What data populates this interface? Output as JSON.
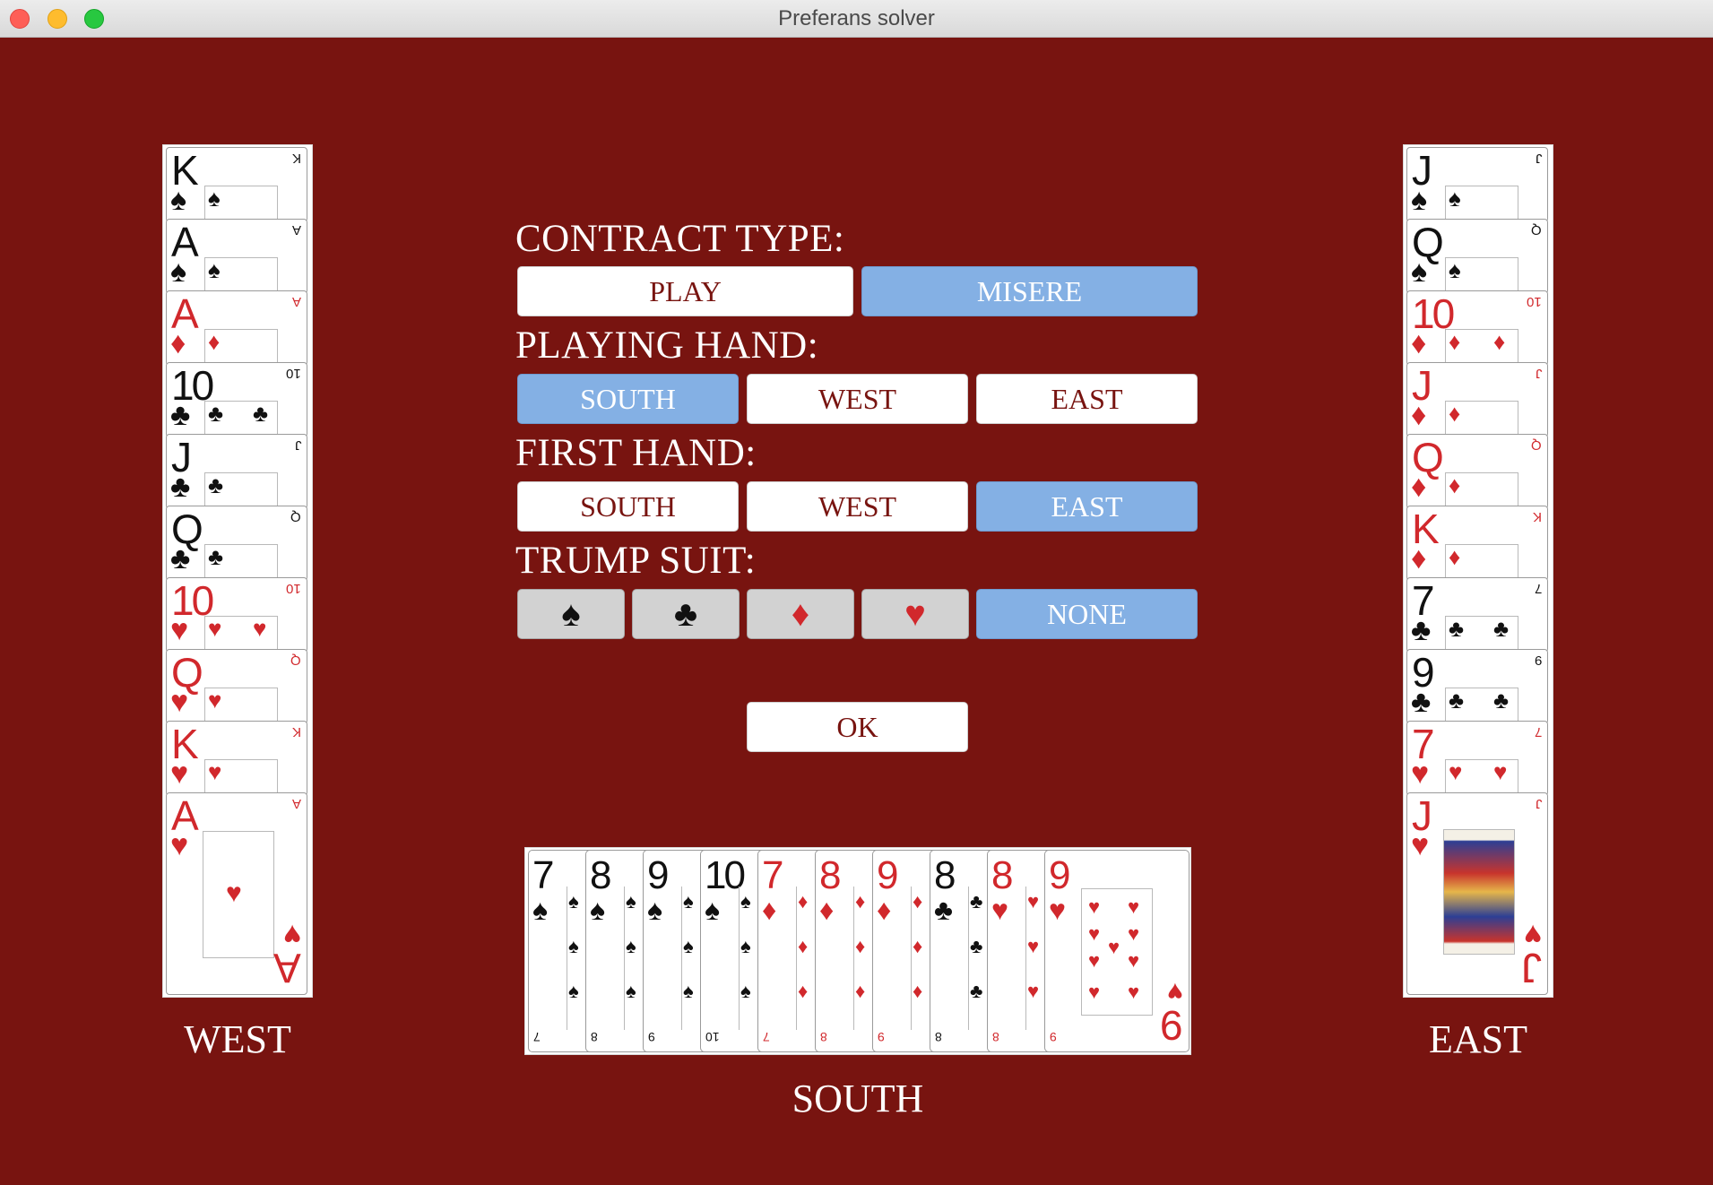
{
  "window": {
    "title": "Preferans solver"
  },
  "colors": {
    "table": "#781410",
    "selected": "#84b0e4",
    "red_suit": "#d1282c",
    "black_suit": "#111111"
  },
  "west": {
    "label": "WEST",
    "cards": [
      {
        "rank": "K",
        "suit": "♠",
        "color": "black"
      },
      {
        "rank": "A",
        "suit": "♠",
        "color": "black"
      },
      {
        "rank": "A",
        "suit": "♦",
        "color": "red"
      },
      {
        "rank": "10",
        "suit": "♣",
        "color": "black"
      },
      {
        "rank": "J",
        "suit": "♣",
        "color": "black"
      },
      {
        "rank": "Q",
        "suit": "♣",
        "color": "black"
      },
      {
        "rank": "10",
        "suit": "♥",
        "color": "red"
      },
      {
        "rank": "Q",
        "suit": "♥",
        "color": "red"
      },
      {
        "rank": "K",
        "suit": "♥",
        "color": "red"
      },
      {
        "rank": "A",
        "suit": "♥",
        "color": "red"
      }
    ]
  },
  "east": {
    "label": "EAST",
    "cards": [
      {
        "rank": "J",
        "suit": "♠",
        "color": "black"
      },
      {
        "rank": "Q",
        "suit": "♠",
        "color": "black"
      },
      {
        "rank": "10",
        "suit": "♦",
        "color": "red"
      },
      {
        "rank": "J",
        "suit": "♦",
        "color": "red"
      },
      {
        "rank": "Q",
        "suit": "♦",
        "color": "red"
      },
      {
        "rank": "K",
        "suit": "♦",
        "color": "red"
      },
      {
        "rank": "7",
        "suit": "♣",
        "color": "black"
      },
      {
        "rank": "9",
        "suit": "♣",
        "color": "black"
      },
      {
        "rank": "7",
        "suit": "♥",
        "color": "red"
      },
      {
        "rank": "J",
        "suit": "♥",
        "color": "red"
      }
    ]
  },
  "south": {
    "label": "SOUTH",
    "cards": [
      {
        "rank": "7",
        "suit": "♠",
        "color": "black"
      },
      {
        "rank": "8",
        "suit": "♠",
        "color": "black"
      },
      {
        "rank": "9",
        "suit": "♠",
        "color": "black"
      },
      {
        "rank": "10",
        "suit": "♠",
        "color": "black"
      },
      {
        "rank": "7",
        "suit": "♦",
        "color": "red"
      },
      {
        "rank": "8",
        "suit": "♦",
        "color": "red"
      },
      {
        "rank": "9",
        "suit": "♦",
        "color": "red"
      },
      {
        "rank": "8",
        "suit": "♣",
        "color": "black"
      },
      {
        "rank": "8",
        "suit": "♥",
        "color": "red"
      },
      {
        "rank": "9",
        "suit": "♥",
        "color": "red"
      }
    ]
  },
  "contract_type": {
    "label": "CONTRACT TYPE:",
    "options": [
      {
        "label": "PLAY",
        "selected": false
      },
      {
        "label": "MISERE",
        "selected": true
      }
    ]
  },
  "playing_hand": {
    "label": "PLAYING HAND:",
    "options": [
      {
        "label": "SOUTH",
        "selected": true
      },
      {
        "label": "WEST",
        "selected": false
      },
      {
        "label": "EAST",
        "selected": false
      }
    ]
  },
  "first_hand": {
    "label": "FIRST HAND:",
    "options": [
      {
        "label": "SOUTH",
        "selected": false
      },
      {
        "label": "WEST",
        "selected": false
      },
      {
        "label": "EAST",
        "selected": true
      }
    ]
  },
  "trump_suit": {
    "label": "TRUMP SUIT:",
    "options": [
      {
        "label": "♠",
        "icon": "spade-icon",
        "selected": false
      },
      {
        "label": "♣",
        "icon": "club-icon",
        "selected": false
      },
      {
        "label": "♦",
        "icon": "diamond-icon",
        "selected": false
      },
      {
        "label": "♥",
        "icon": "heart-icon",
        "selected": false
      },
      {
        "label": "NONE",
        "selected": true
      }
    ]
  },
  "ok_button": {
    "label": "OK"
  }
}
